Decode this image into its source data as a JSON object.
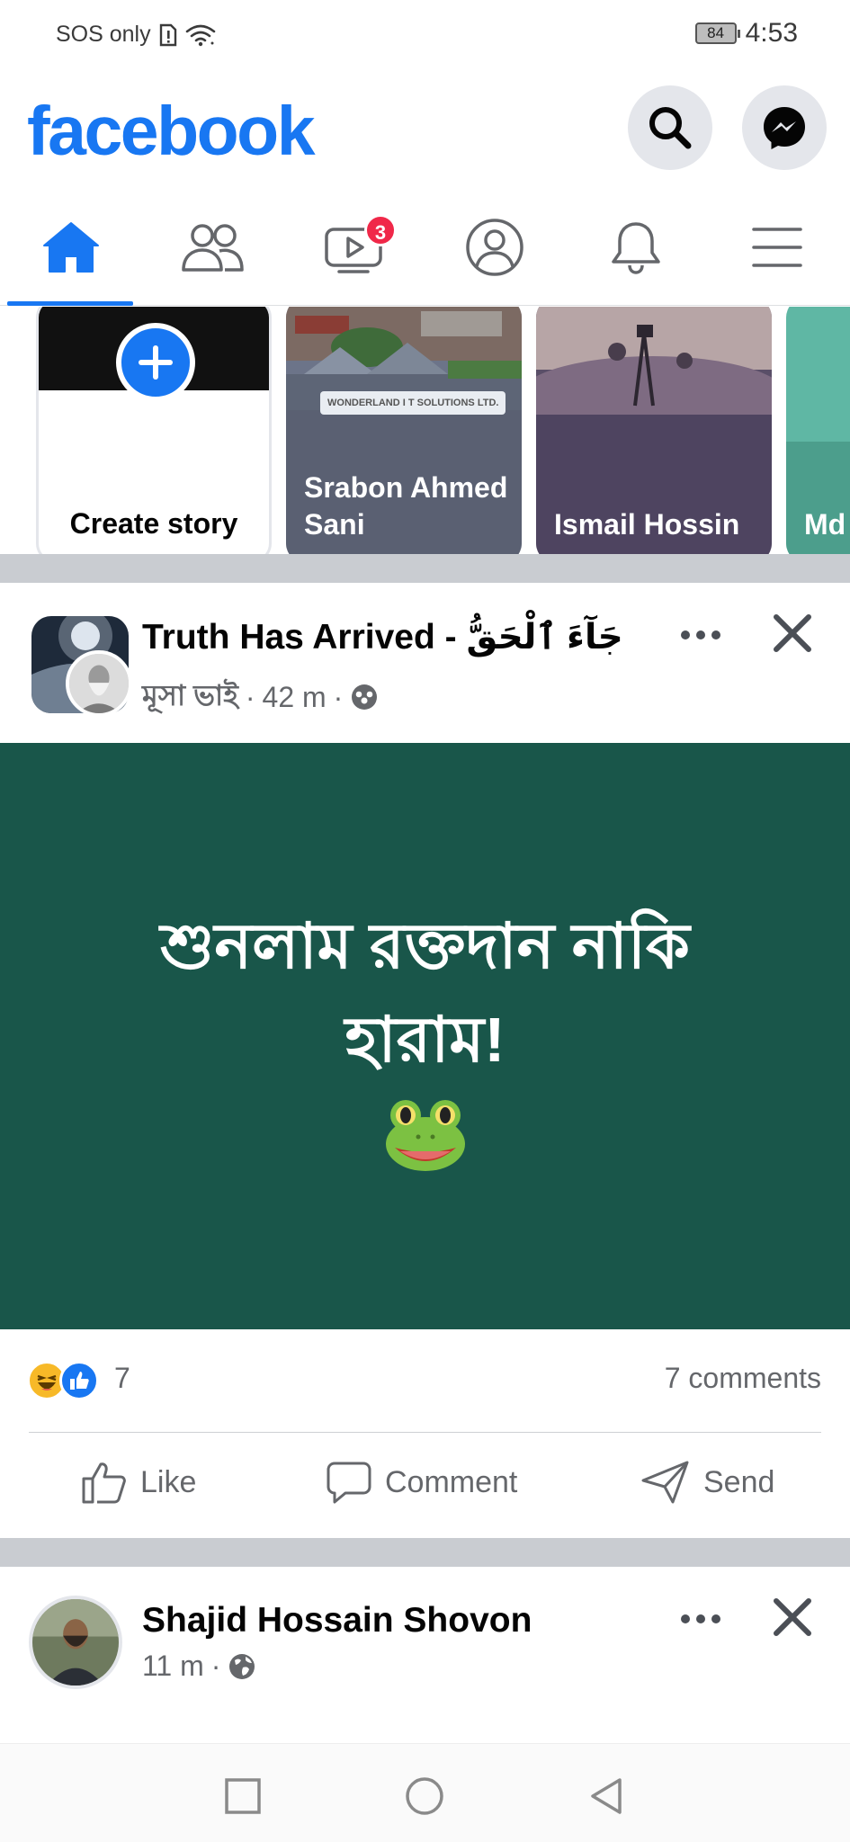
{
  "status_bar": {
    "network": "SOS only",
    "battery": "84",
    "time": "4:53"
  },
  "header": {
    "logo": "facebook",
    "search_icon": "search-icon",
    "messenger_icon": "messenger-icon",
    "brand_color": "#1877f2"
  },
  "tabs": [
    {
      "name": "home",
      "icon": "home-icon",
      "active": true
    },
    {
      "name": "friends",
      "icon": "friends-icon"
    },
    {
      "name": "watch",
      "icon": "video-icon",
      "badge": "3"
    },
    {
      "name": "profile",
      "icon": "profile-icon"
    },
    {
      "name": "notifications",
      "icon": "bell-icon"
    },
    {
      "name": "menu",
      "icon": "menu-icon"
    }
  ],
  "stories": {
    "create_label": "Create story",
    "items": [
      {
        "name": "Srabon Ahmed Sani",
        "chip": "WONDERLAND I T SOLUTIONS LTD."
      },
      {
        "name": "Ismail Hossin"
      },
      {
        "name": "Md Has"
      }
    ]
  },
  "post1": {
    "page_name": "Truth Has Arrived - جَآءَ ٱلْحَقُّ",
    "author": "মূসা ভাই",
    "time": "42 m",
    "privacy_icon": "group-icon",
    "text": "শুনলাম রক্তদান নাকি হারাম!",
    "emoji": "frog-emoji",
    "bg_color": "#19564a",
    "reaction_count": "7",
    "comments": "7 comments",
    "actions": {
      "like": "Like",
      "comment": "Comment",
      "send": "Send"
    }
  },
  "post2": {
    "name": "Shajid Hossain Shovon",
    "time": "11 m",
    "privacy_icon": "globe-icon"
  },
  "nav": {
    "recent_icon": "square-icon",
    "home_icon": "circle-icon",
    "back_icon": "triangle-back-icon"
  }
}
